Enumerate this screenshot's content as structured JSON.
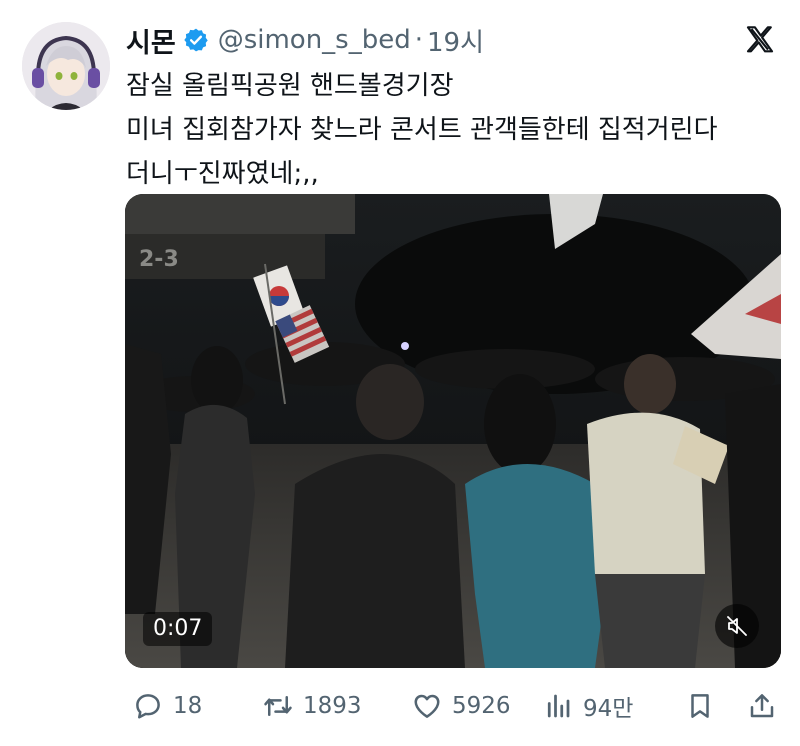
{
  "tweet": {
    "author": {
      "display_name": "시몬",
      "handle": "@simon_s_bed",
      "verified": true,
      "verified_color": "#1d9bf0"
    },
    "separator": "·",
    "time": "19시",
    "text_lines": [
      "잠실 올림픽공원 핸드볼경기장",
      "미녀 집회참가자 찾느라 콘서트 관객들한테 집적거린다",
      "더니ㅜ진짜였네;,,"
    ],
    "media": {
      "type": "video",
      "timestamp": "0:07",
      "muted": true
    },
    "actions": {
      "replies": "18",
      "retweets": "1893",
      "likes": "5926",
      "views": "94만"
    }
  },
  "icons": {
    "platform": "x-logo-icon",
    "reply": "speech-bubble-icon",
    "retweet": "retweet-arrows-icon",
    "like": "heart-icon",
    "views": "bar-chart-icon",
    "bookmark": "bookmark-icon",
    "share": "share-upload-icon",
    "mute": "speaker-muted-icon"
  }
}
